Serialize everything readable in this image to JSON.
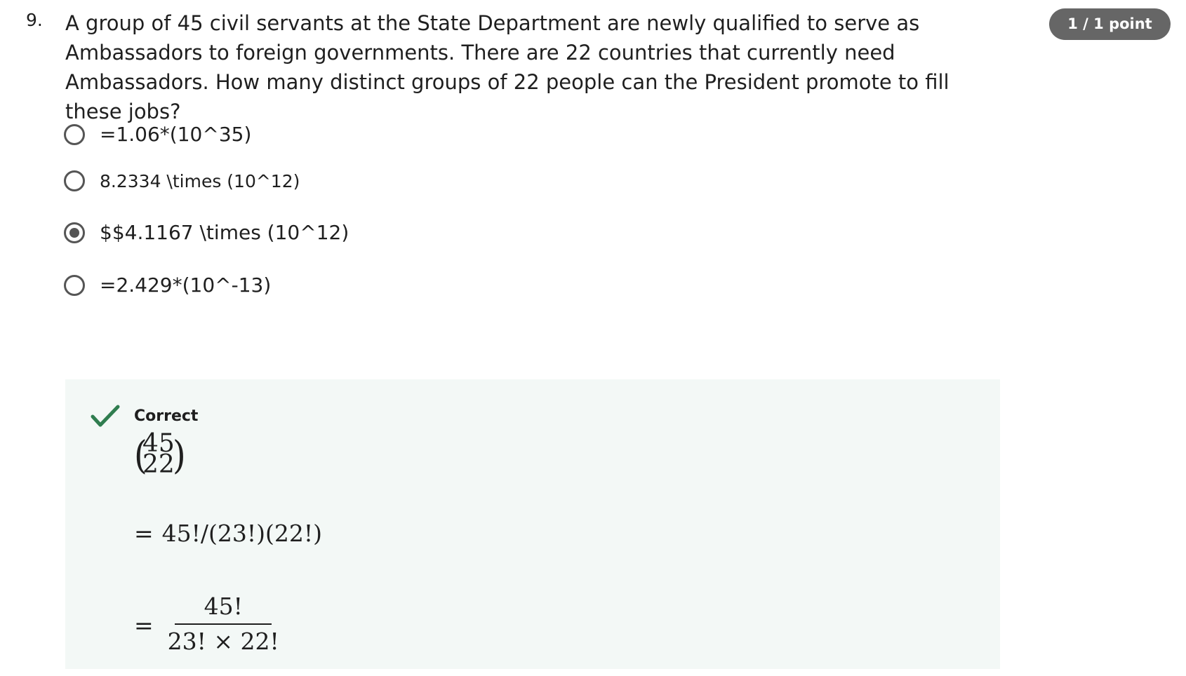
{
  "question": {
    "number": "9.",
    "text": "A group of 45 civil servants at the State Department are newly qualified to serve as Ambassadors to foreign governments. There are 22 countries that currently need Ambassadors. How many distinct groups of 22 people can the President promote to fill these jobs?",
    "points": "1 / 1 point"
  },
  "options": [
    {
      "label": "=1.06*(10^35)",
      "selected": false
    },
    {
      "label": "8.2334 \\times (10^12)",
      "selected": false
    },
    {
      "label": "$$4.1167 \\times (10^12)",
      "selected": true
    },
    {
      "label": "=2.429*(10^-13)",
      "selected": false
    }
  ],
  "feedback": {
    "status": "Correct",
    "status_color": "#2f7d4f",
    "binom_top": "45",
    "binom_bottom": "22",
    "equals": "=",
    "line1": "45!/(23!)(22!)",
    "frac_numerator": "45!",
    "frac_denominator": "23! × 22!"
  },
  "icons": {
    "check": "check-icon",
    "radio": "radio-icon"
  }
}
